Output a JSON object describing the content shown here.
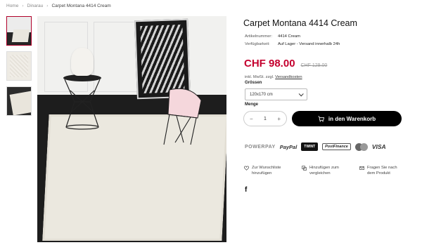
{
  "breadcrumb": {
    "home": "Home",
    "category": "Dinarau",
    "current": "Carpet Montana 4414 Cream"
  },
  "product": {
    "title": "Carpet Montana 4414 Cream",
    "meta": [
      {
        "key": "Artikelnummer:",
        "value": "4414 Cream"
      },
      {
        "key": "Verfügbarkeit:",
        "value": "Auf Lager - Versand innerhalb 24h"
      }
    ],
    "price": "CHF 98.00",
    "old_price": "CHF 129.00",
    "tax_note": "inkl. MwSt. zzgl.",
    "tax_link": "Versandkosten",
    "size_label": "Grössen",
    "size_value": "120x170 cm",
    "qty_label": "Menge",
    "qty_value": "1",
    "cart_button": "in den Warenkorb"
  },
  "payments": {
    "powerpay": "POWERPAY",
    "paypal": "PayPal",
    "twint": "TWINT",
    "postfinance": "PostFinance",
    "visa": "VISA"
  },
  "actions": {
    "wishlist": "Zur Wunschliste hinzufügen",
    "compare": "Hinzufügen zum vergleichen",
    "ask": "Fragen Sie nach dem Produkt"
  },
  "social": {
    "facebook": "f"
  },
  "colors": {
    "accent": "#c4002e",
    "button": "#000000"
  },
  "icons": [
    "heart-icon",
    "compare-icon",
    "mail-icon",
    "cart-icon",
    "chevron-down-icon",
    "facebook-icon"
  ]
}
